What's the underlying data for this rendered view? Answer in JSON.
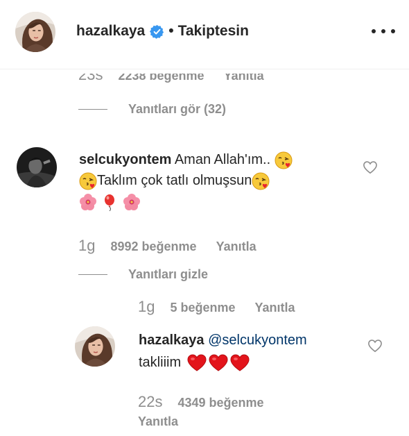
{
  "header": {
    "username": "hazalkaya",
    "separator": "•",
    "follow_status": "Takiptesin",
    "avatar": "profile-photo-hazalkaya",
    "verified_icon": "verified-badge-icon",
    "more_icon": "more-options-icon"
  },
  "prev_comment": {
    "time": "23s",
    "likes": "2238 beğenme",
    "reply_label": "Yanıtla"
  },
  "view_replies": {
    "label": "Yanıtları gör (32)"
  },
  "comment": {
    "username": "selcukyontem",
    "line1": "Aman Allah'ım..",
    "line2": "Taklım çok tatlı olmuşsun",
    "emojis_line1": [
      "face-blowing-kiss"
    ],
    "emojis_line2": [
      "face-blowing-kiss",
      "face-blowing-kiss"
    ],
    "emojis_line3": [
      "hibiscus",
      "balloon",
      "hibiscus"
    ],
    "time": "1g",
    "likes": "8992 beğenme",
    "reply_label": "Yanıtla",
    "hide_replies_label": "Yanıtları gizle"
  },
  "reply_meta": {
    "time": "1g",
    "likes": "5 beğenme",
    "reply_label": "Yanıtla"
  },
  "reply": {
    "username": "hazalkaya",
    "mention": "@selcukyontem",
    "text": "takliiim",
    "emojis": [
      "red-heart",
      "red-heart",
      "red-heart"
    ],
    "time": "22s",
    "likes": "4349 beğenme",
    "reply_label": "Yanıtla"
  },
  "colors": {
    "text": "#262626",
    "muted": "#8e8e8e",
    "mention": "#003569",
    "verified": "#3897f0",
    "heart": "#ed1c24"
  }
}
